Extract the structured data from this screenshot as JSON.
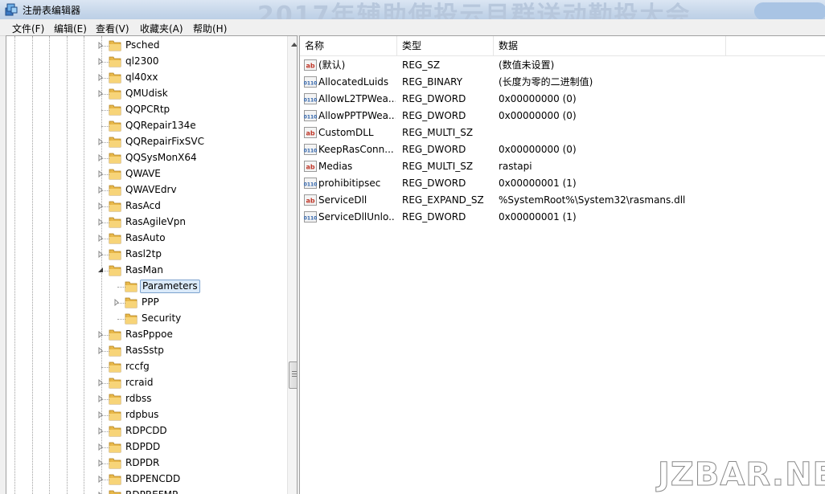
{
  "window": {
    "title": "注册表编辑器",
    "background_banner": "2017年辅助使投云目群送动勤投大会"
  },
  "menu": [
    {
      "label": "文件(F)"
    },
    {
      "label": "编辑(E)"
    },
    {
      "label": "查看(V)"
    },
    {
      "label": "收藏夹(A)"
    },
    {
      "label": "帮助(H)"
    }
  ],
  "tree": [
    {
      "label": "Psched",
      "expandable": true,
      "selected": false
    },
    {
      "label": "ql2300",
      "expandable": true,
      "selected": false
    },
    {
      "label": "ql40xx",
      "expandable": true,
      "selected": false
    },
    {
      "label": "QMUdisk",
      "expandable": true,
      "selected": false
    },
    {
      "label": "QQPCRtp",
      "expandable": false,
      "selected": false
    },
    {
      "label": "QQRepair134e",
      "expandable": false,
      "selected": false
    },
    {
      "label": "QQRepairFixSVC",
      "expandable": true,
      "selected": false
    },
    {
      "label": "QQSysMonX64",
      "expandable": true,
      "selected": false
    },
    {
      "label": "QWAVE",
      "expandable": true,
      "selected": false
    },
    {
      "label": "QWAVEdrv",
      "expandable": true,
      "selected": false
    },
    {
      "label": "RasAcd",
      "expandable": true,
      "selected": false
    },
    {
      "label": "RasAgileVpn",
      "expandable": true,
      "selected": false
    },
    {
      "label": "RasAuto",
      "expandable": true,
      "selected": false
    },
    {
      "label": "Rasl2tp",
      "expandable": true,
      "selected": false
    },
    {
      "label": "RasMan",
      "expandable": true,
      "expanded": true,
      "selected": false
    },
    {
      "label": "Parameters",
      "expandable": false,
      "selected": true,
      "child": true
    },
    {
      "label": "PPP",
      "expandable": true,
      "selected": false,
      "child": true
    },
    {
      "label": "Security",
      "expandable": false,
      "selected": false,
      "child": true
    },
    {
      "label": "RasPppoe",
      "expandable": true,
      "selected": false
    },
    {
      "label": "RasSstp",
      "expandable": true,
      "selected": false
    },
    {
      "label": "rccfg",
      "expandable": false,
      "selected": false
    },
    {
      "label": "rcraid",
      "expandable": true,
      "selected": false
    },
    {
      "label": "rdbss",
      "expandable": true,
      "selected": false
    },
    {
      "label": "rdpbus",
      "expandable": true,
      "selected": false
    },
    {
      "label": "RDPCDD",
      "expandable": true,
      "selected": false
    },
    {
      "label": "RDPDD",
      "expandable": true,
      "selected": false
    },
    {
      "label": "RDPDR",
      "expandable": true,
      "selected": false
    },
    {
      "label": "RDPENCDD",
      "expandable": true,
      "selected": false
    },
    {
      "label": "RDPREFMP",
      "expandable": true,
      "selected": false
    }
  ],
  "columns": {
    "name": "名称",
    "type": "类型",
    "data": "数据"
  },
  "values": [
    {
      "name": "(默认)",
      "type": "REG_SZ",
      "data": "(数值未设置)",
      "icon": "string-value-icon"
    },
    {
      "name": "AllocatedLuids",
      "type": "REG_BINARY",
      "data": "(长度为零的二进制值)",
      "icon": "binary-value-icon"
    },
    {
      "name": "AllowL2TPWea...",
      "type": "REG_DWORD",
      "data": "0x00000000 (0)",
      "icon": "binary-value-icon"
    },
    {
      "name": "AllowPPTPWea...",
      "type": "REG_DWORD",
      "data": "0x00000000 (0)",
      "icon": "binary-value-icon"
    },
    {
      "name": "CustomDLL",
      "type": "REG_MULTI_SZ",
      "data": "",
      "icon": "string-value-icon"
    },
    {
      "name": "KeepRasConn...",
      "type": "REG_DWORD",
      "data": "0x00000000 (0)",
      "icon": "binary-value-icon"
    },
    {
      "name": "Medias",
      "type": "REG_MULTI_SZ",
      "data": "rastapi",
      "icon": "string-value-icon"
    },
    {
      "name": "prohibitipsec",
      "type": "REG_DWORD",
      "data": "0x00000001 (1)",
      "icon": "binary-value-icon"
    },
    {
      "name": "ServiceDll",
      "type": "REG_EXPAND_SZ",
      "data": "%SystemRoot%\\System32\\rasmans.dll",
      "icon": "string-value-icon"
    },
    {
      "name": "ServiceDllUnlo...",
      "type": "REG_DWORD",
      "data": "0x00000001 (1)",
      "icon": "binary-value-icon"
    }
  ],
  "watermark": "JZBAR.NET"
}
